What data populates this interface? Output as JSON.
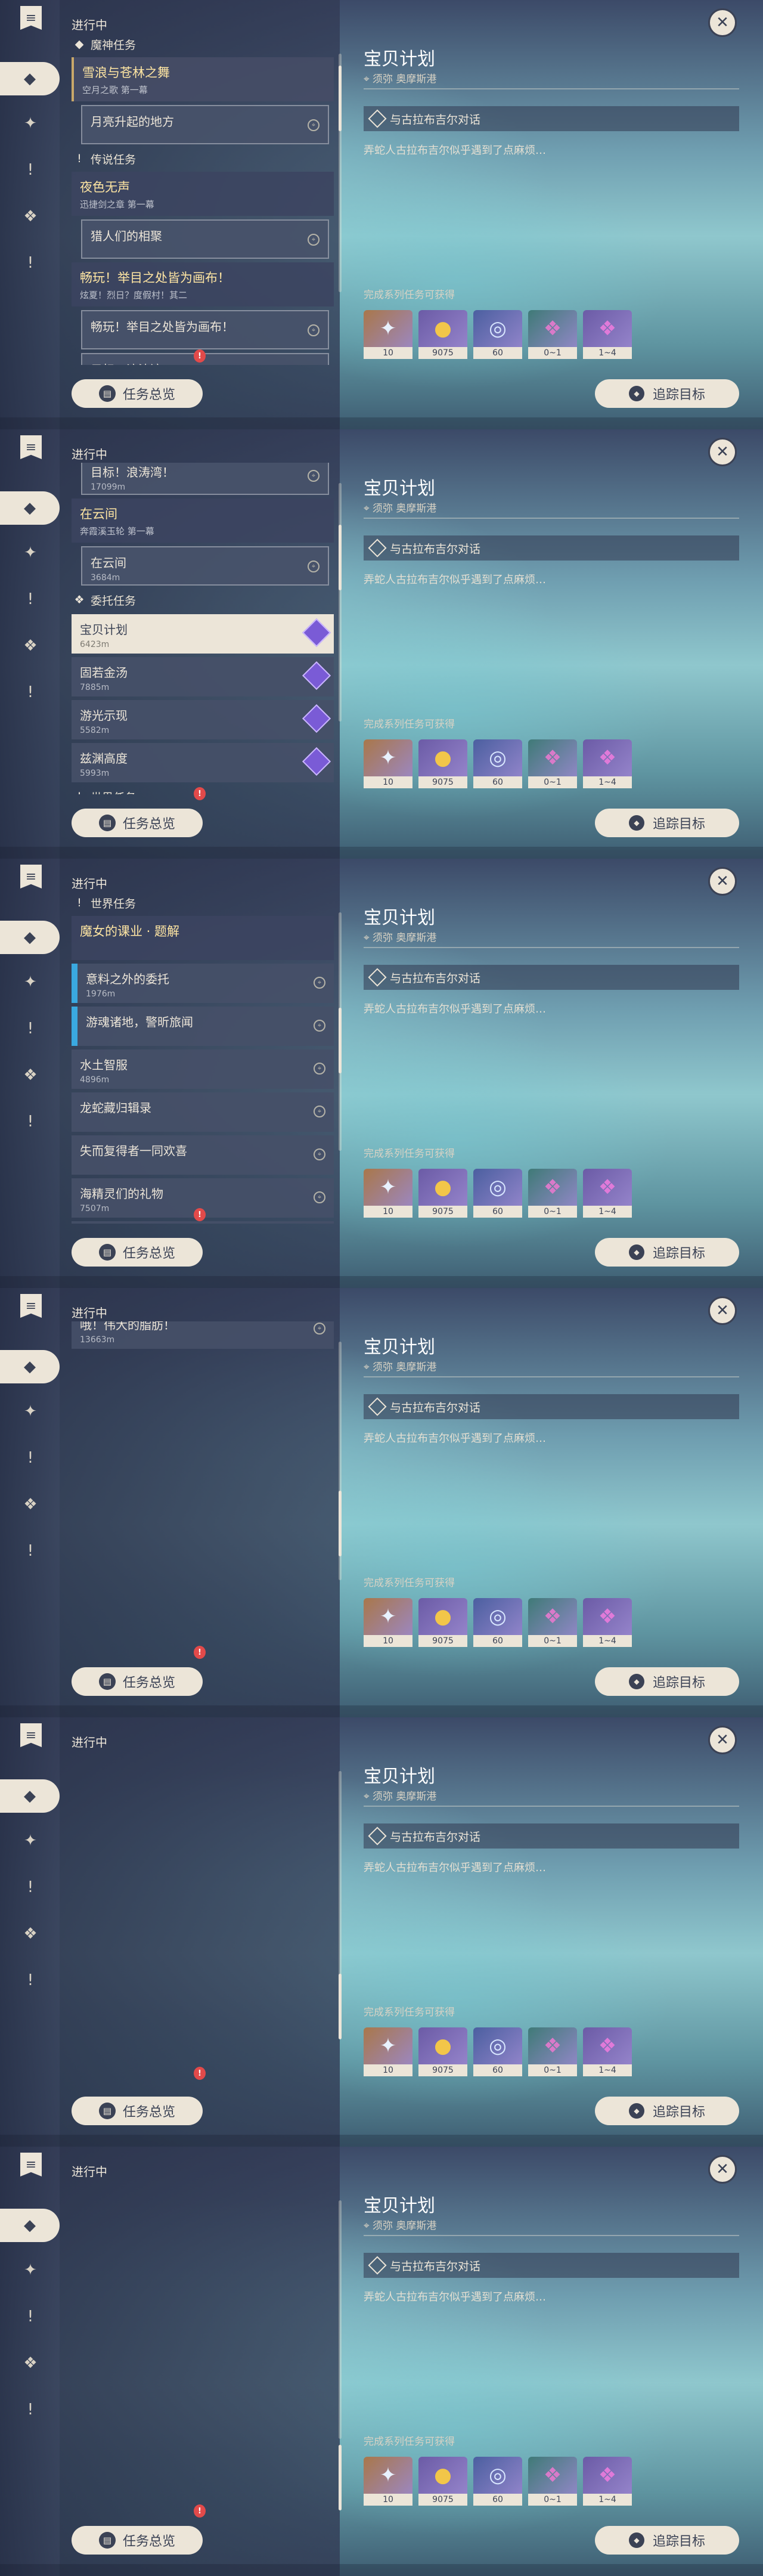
{
  "header": {
    "status": "进行中"
  },
  "buttons": {
    "overview": "任务总览",
    "track": "追踪目标"
  },
  "detail": {
    "title": "宝贝计划",
    "location": "须弥 奥摩斯港",
    "objective": "与古拉布吉尔对话",
    "description": "弄蛇人古拉布吉尔似乎遇到了点麻烦…",
    "rewards_label": "完成系列任务可获得",
    "rewards": [
      {
        "icon": "primogem-icon",
        "count": "10",
        "bg": "#a9774a"
      },
      {
        "icon": "mora-icon",
        "count": "9075",
        "bg": "#6b5ba6"
      },
      {
        "icon": "adventure-exp-icon",
        "count": "60",
        "bg": "#4b5fa0"
      },
      {
        "icon": "green-crystal-icon",
        "count": "0~1",
        "bg": "#3f7a77"
      },
      {
        "icon": "purple-crystal-icon",
        "count": "1~4",
        "bg": "#6b5ba6"
      }
    ]
  },
  "list": {
    "archon_header": "魔神任务",
    "archon_group": {
      "title": "雪浪与苍林之舞",
      "sub": "空月之歌 第一幕"
    },
    "archon_quest": "月亮升起的地方",
    "legend_header": "传说任务",
    "legend_group": {
      "title": "夜色无声",
      "sub": "迅捷剑之章 第一幕"
    },
    "legend_quest": "猎人们的相聚",
    "event_group": {
      "title": "畅玩！举目之处皆为画布！",
      "sub": "炫夏！烈日？度假村！其二"
    },
    "event_quest_1": "畅玩！举目之处皆为画布！",
    "event_quest_2": {
      "title": "目标！浪涛湾！",
      "dist": "17099m"
    },
    "cloud_group": {
      "title": "在云间",
      "sub": "奔霞溪玉轮 第一幕"
    },
    "cloud_quest": {
      "title": "在云间",
      "dist": "3684m"
    },
    "commission_header": "委托任务",
    "commissions": [
      {
        "title": "宝贝计划",
        "dist": "6423m"
      },
      {
        "title": "固若金汤",
        "dist": "7885m"
      },
      {
        "title": "游光示现",
        "dist": "5582m"
      },
      {
        "title": "兹渊高度",
        "dist": "5993m"
      }
    ],
    "world_header": "世界任务",
    "world_group": {
      "title": "魔女的课业 · 题解"
    },
    "world_quests": [
      {
        "title": "意料之外的委托",
        "dist": "1976m"
      },
      {
        "title": "游魂诸地，警昕旅闻",
        "dist": ""
      },
      {
        "title": "水土智服",
        "dist": "4896m"
      },
      {
        "title": "龙蛇藏归辑录",
        "dist": ""
      },
      {
        "title": "失而复得者一同欢喜",
        "dist": ""
      },
      {
        "title": "海精灵们的礼物",
        "dist": "7507m"
      },
      {
        "title": "哦！伟大的脂肪！",
        "dist": "13663m"
      }
    ]
  }
}
